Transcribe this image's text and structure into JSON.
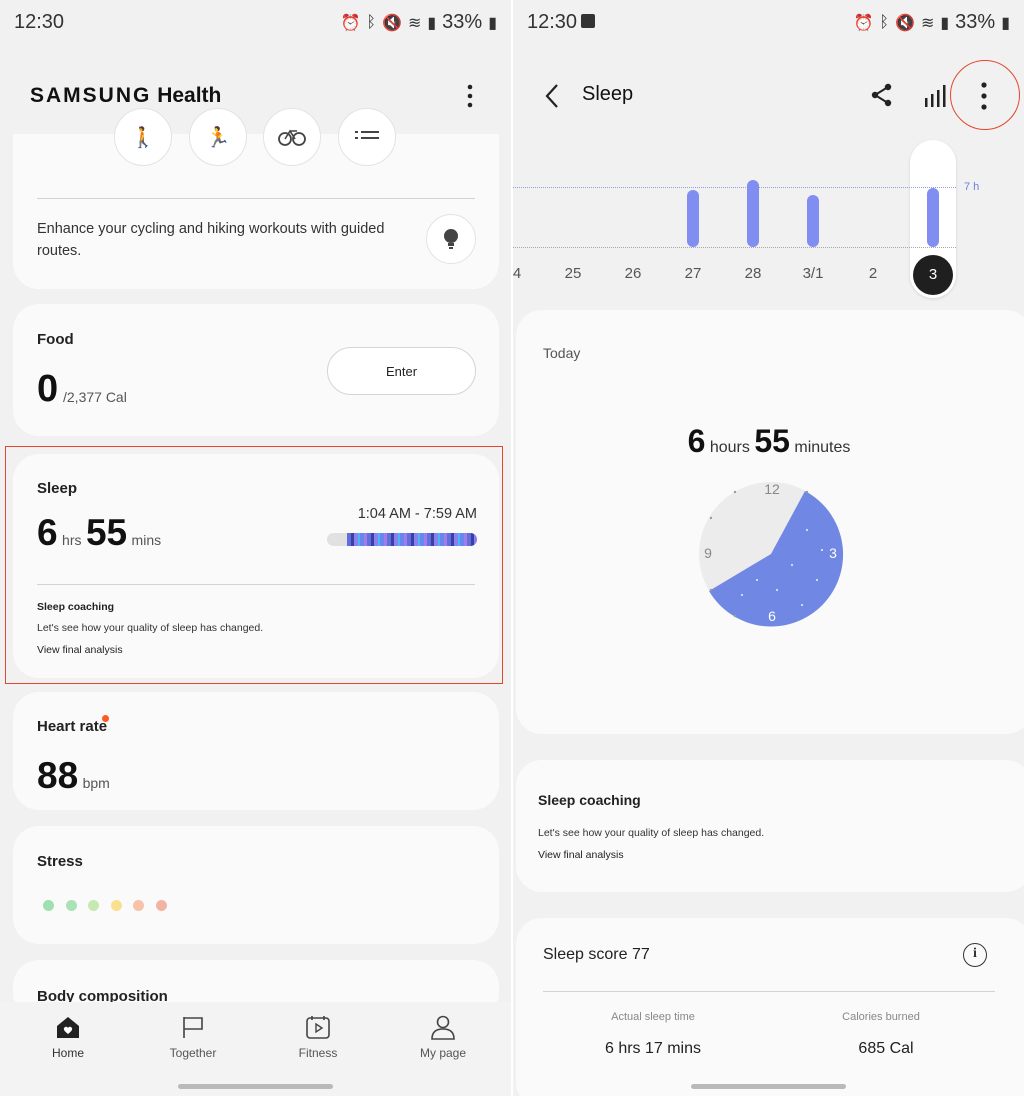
{
  "left": {
    "status": {
      "time": "12:30",
      "battery": "33%"
    },
    "header": {
      "title_brand": "SAMSUNG",
      "title_app": "Health"
    },
    "routes": {
      "text": "Enhance your cycling and hiking workouts with guided routes."
    },
    "food": {
      "title": "Food",
      "value": "0",
      "goal": "/2,377 Cal",
      "button": "Enter"
    },
    "sleep": {
      "title": "Sleep",
      "hours": "6",
      "hours_unit": "hrs",
      "minutes": "55",
      "minutes_unit": "mins",
      "range": "1:04 AM - 7:59 AM",
      "coaching_title": "Sleep coaching",
      "coaching_text": "Let's see how your quality of sleep has changed.",
      "coaching_link": "View final analysis"
    },
    "heart": {
      "title": "Heart rate",
      "value": "88",
      "unit": "bpm"
    },
    "stress": {
      "title": "Stress",
      "dot_colors": [
        "#9fdfb0",
        "#a8e2b6",
        "#c6e9b2",
        "#f8e08e",
        "#f6c3a8",
        "#f3b3a3"
      ]
    },
    "body": {
      "title": "Body composition"
    },
    "nav": [
      {
        "label": "Home",
        "icon": "home-heart-icon"
      },
      {
        "label": "Together",
        "icon": "flag-icon"
      },
      {
        "label": "Fitness",
        "icon": "calendar-play-icon"
      },
      {
        "label": "My page",
        "icon": "person-icon"
      }
    ]
  },
  "right": {
    "status": {
      "time": "12:30",
      "battery": "33%"
    },
    "header": {
      "title": "Sleep"
    },
    "chart_data": {
      "type": "bar",
      "categories": [
        "4",
        "25",
        "26",
        "27",
        "28",
        "3/1",
        "2",
        "3"
      ],
      "values": [
        null,
        null,
        null,
        6.7,
        7.8,
        6.1,
        null,
        6.9
      ],
      "selected": "3",
      "reference_label": "7 h",
      "unit": "hours"
    },
    "today": {
      "label": "Today",
      "hours": "6",
      "hours_unit": "hours",
      "minutes": "55",
      "minutes_unit": "minutes",
      "clock": {
        "n12": "12",
        "n3": "3",
        "n6": "6",
        "n9": "9"
      },
      "clock_colors": {
        "sleep": "#7088e4",
        "face": "#ececec"
      }
    },
    "coaching": {
      "title": "Sleep coaching",
      "text": "Let's see how your quality of sleep has changed.",
      "link": "View final analysis"
    },
    "score": {
      "title": "Sleep score 77",
      "actual_label": "Actual sleep time",
      "actual_value": "6 hrs 17 mins",
      "cal_label": "Calories burned",
      "cal_value": "685 Cal"
    }
  }
}
